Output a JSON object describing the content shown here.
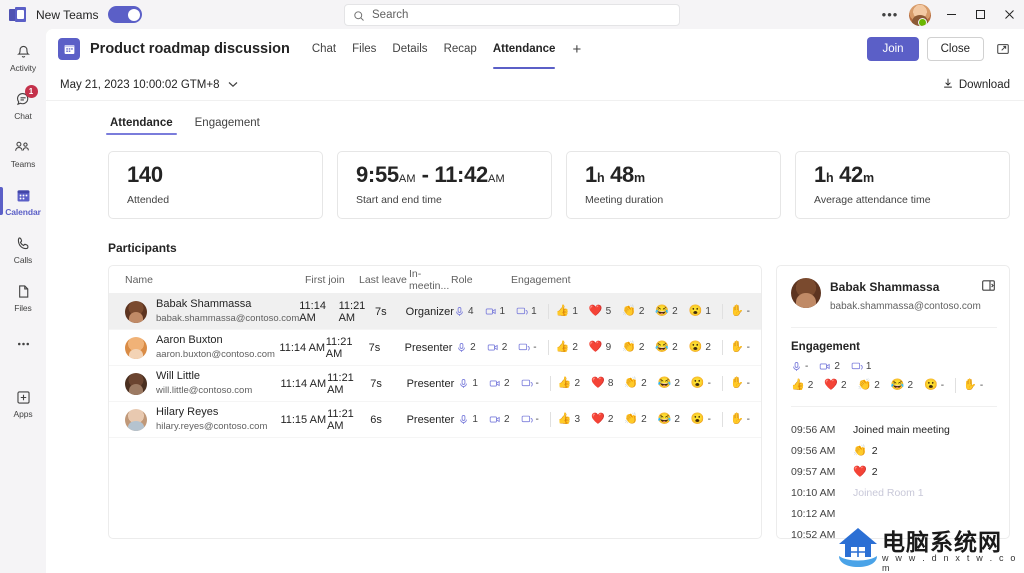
{
  "titlebar": {
    "app_name": "New Teams",
    "toggle_on": true,
    "search_placeholder": "Search",
    "more_label": "•••",
    "minimize_label": "Minimize",
    "maximize_label": "Maximize",
    "close_label": "Close"
  },
  "rail": {
    "items": [
      {
        "label": "Activity",
        "icon": "bell-icon",
        "badge": ""
      },
      {
        "label": "Chat",
        "icon": "chat-icon",
        "badge": "1"
      },
      {
        "label": "Teams",
        "icon": "teams-icon",
        "badge": ""
      },
      {
        "label": "Calendar",
        "icon": "calendar-icon",
        "badge": ""
      },
      {
        "label": "Calls",
        "icon": "phone-icon",
        "badge": ""
      },
      {
        "label": "Files",
        "icon": "file-icon",
        "badge": ""
      },
      {
        "label": "",
        "icon": "more-icon",
        "badge": ""
      },
      {
        "label": "Apps",
        "icon": "apps-icon",
        "badge": ""
      }
    ],
    "active_index": 3
  },
  "header": {
    "meeting_title": "Product roadmap discussion",
    "tabs": [
      "Chat",
      "Files",
      "Details",
      "Recap",
      "Attendance"
    ],
    "active_tab": "Attendance",
    "add_tab_label": "+",
    "join_label": "Join",
    "close_label": "Close",
    "popout_label": "Pop out"
  },
  "date_row": {
    "date_text": "May 21, 2023 10:00:02 GTM+8",
    "download_label": "Download"
  },
  "subtabs": {
    "items": [
      "Attendance",
      "Engagement"
    ],
    "active": "Attendance"
  },
  "summary_cards": [
    {
      "value": "140",
      "unit": "",
      "value2": "",
      "unit2": "",
      "label": "Attended"
    },
    {
      "value": "9:55",
      "unit": "AM",
      "value2": "- 11:42",
      "unit2": "AM",
      "label": "Start and end time"
    },
    {
      "value": "1",
      "unit": "h",
      "value2": "48",
      "unit2": "m",
      "label": "Meeting duration"
    },
    {
      "value": "1",
      "unit": "h",
      "value2": "42",
      "unit2": "m",
      "label": "Average attendance time"
    }
  ],
  "participants": {
    "section_title": "Participants",
    "columns": [
      "Name",
      "First join",
      "Last leave",
      "In-meetin...",
      "Role",
      "Engagement"
    ],
    "rows": [
      {
        "name": "Babak Shammassa",
        "email": "babak.shammassa@contoso.com",
        "first_join": "11:14 AM",
        "last_leave": "11:21 AM",
        "in_meeting": "7s",
        "role": "Organizer",
        "mic": "4",
        "camera": "1",
        "share": "1",
        "thumbs": "1",
        "heart": "5",
        "clap": "2",
        "laugh": "2",
        "surprise": "1",
        "hand": "-",
        "selected": true
      },
      {
        "name": "Aaron Buxton",
        "email": "aaron.buxton@contoso.com",
        "first_join": "11:14 AM",
        "last_leave": "11:21 AM",
        "in_meeting": "7s",
        "role": "Presenter",
        "mic": "2",
        "camera": "2",
        "share": "-",
        "thumbs": "2",
        "heart": "9",
        "clap": "2",
        "laugh": "2",
        "surprise": "2",
        "hand": "-",
        "selected": false
      },
      {
        "name": "Will Little",
        "email": "will.little@contoso.com",
        "first_join": "11:14 AM",
        "last_leave": "11:21 AM",
        "in_meeting": "7s",
        "role": "Presenter",
        "mic": "1",
        "camera": "2",
        "share": "-",
        "thumbs": "2",
        "heart": "8",
        "clap": "2",
        "laugh": "2",
        "surprise": "-",
        "hand": "-",
        "selected": false
      },
      {
        "name": "Hilary Reyes",
        "email": "hilary.reyes@contoso.com",
        "first_join": "11:15 AM",
        "last_leave": "11:21 AM",
        "in_meeting": "6s",
        "role": "Presenter",
        "mic": "1",
        "camera": "2",
        "share": "-",
        "thumbs": "3",
        "heart": "2",
        "clap": "2",
        "laugh": "2",
        "surprise": "-",
        "hand": "-",
        "selected": false
      }
    ]
  },
  "detail_panel": {
    "name": "Babak Shammassa",
    "email": "babak.shammassa@contoso.com",
    "expand_label": "Expand",
    "engagement_title": "Engagement",
    "mic": "-",
    "camera": "2",
    "share": "1",
    "thumbs": "2",
    "heart": "2",
    "clap": "2",
    "laugh": "2",
    "surprise": "-",
    "hand": "-",
    "timeline": [
      {
        "time": "09:56 AM",
        "emoji": "",
        "text": "Joined main meeting",
        "count": ""
      },
      {
        "time": "09:56 AM",
        "emoji": "👏",
        "text": "",
        "count": "2"
      },
      {
        "time": "09:57 AM",
        "emoji": "❤️",
        "text": "",
        "count": "2"
      },
      {
        "time": "10:10 AM",
        "emoji": "",
        "text": "Joined Room 1",
        "count": ""
      },
      {
        "time": "10:12 AM",
        "emoji": "",
        "text": "",
        "count": ""
      },
      {
        "time": "10:52 AM",
        "emoji": "",
        "text": "",
        "count": ""
      }
    ]
  },
  "watermark": {
    "text": "电脑系统网",
    "sub": "w w w . d n x t w . c o m"
  },
  "colors": {
    "accent": "#5b5fc7",
    "badge": "#c4314b",
    "surface": "#ffffff",
    "rail": "#f5f4f6"
  }
}
